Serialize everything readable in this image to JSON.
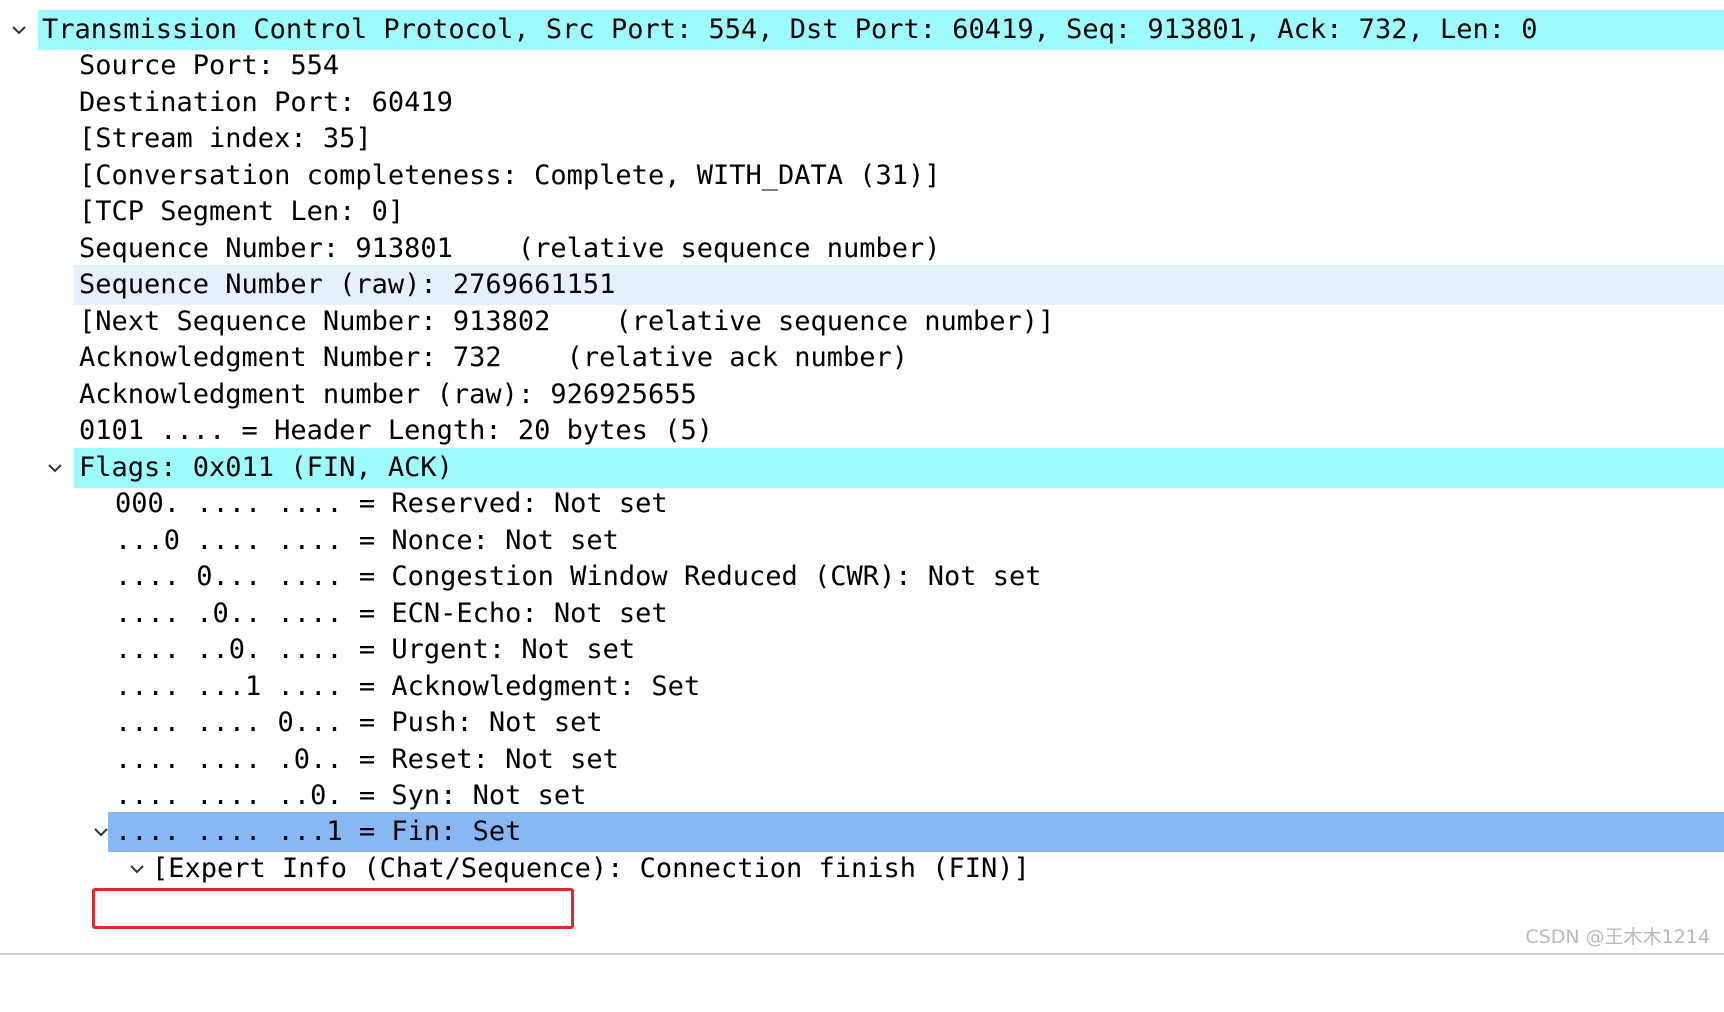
{
  "tcp_header": {
    "summary": "Transmission Control Protocol, Src Port: 554, Dst Port: 60419, Seq: 913801, Ack: 732, Len: 0",
    "fields": [
      "Source Port: 554",
      "Destination Port: 60419",
      "[Stream index: 35]",
      "[Conversation completeness: Complete, WITH_DATA (31)]",
      "[TCP Segment Len: 0]",
      "Sequence Number: 913801    (relative sequence number)",
      "Sequence Number (raw): 2769661151",
      "[Next Sequence Number: 913802    (relative sequence number)]",
      "Acknowledgment Number: 732    (relative ack number)",
      "Acknowledgment number (raw): 926925655",
      "0101 .... = Header Length: 20 bytes (5)"
    ],
    "flags": {
      "summary": "Flags: 0x011 (FIN, ACK)",
      "bits": [
        "000. .... .... = Reserved: Not set",
        "...0 .... .... = Nonce: Not set",
        ".... 0... .... = Congestion Window Reduced (CWR): Not set",
        ".... .0.. .... = ECN-Echo: Not set",
        ".... ..0. .... = Urgent: Not set",
        ".... ...1 .... = Acknowledgment: Set",
        ".... .... 0... = Push: Not set",
        ".... .... .0.. = Reset: Not set",
        ".... .... ..0. = Syn: Not set",
        ".... .... ...1 = Fin: Set"
      ],
      "expert_info": "[Expert Info (Chat/Sequence): Connection finish (FIN)]"
    }
  },
  "watermark": "CSDN @王木木1214",
  "colors": {
    "protocol_highlight": "#9cfbfd",
    "field_highlight": "#e4f1fd",
    "selected_row": "#88b8f4",
    "annotation_box": "#e8262a"
  }
}
